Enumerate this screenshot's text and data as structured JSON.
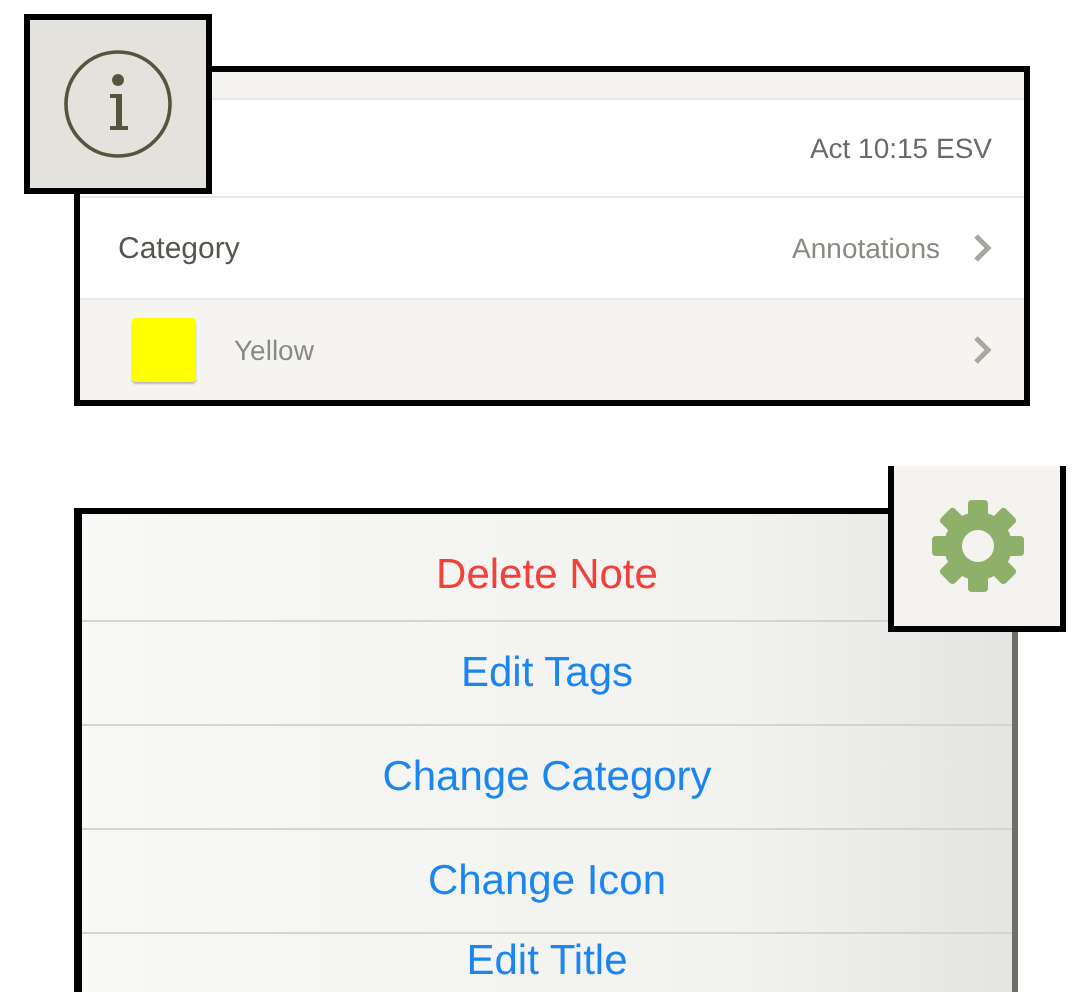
{
  "note_info": {
    "reference": "Act 10:15 ESV",
    "category": {
      "label": "Category",
      "value": "Annotations"
    },
    "highlight": {
      "label": "Yellow",
      "color": "#ffff00"
    }
  },
  "actions": [
    {
      "label": "Delete Note",
      "kind": "destructive"
    },
    {
      "label": "Edit Tags",
      "kind": "normal"
    },
    {
      "label": "Change Category",
      "kind": "normal"
    },
    {
      "label": "Change Icon",
      "kind": "normal"
    },
    {
      "label": "Edit Title",
      "kind": "normal"
    }
  ]
}
